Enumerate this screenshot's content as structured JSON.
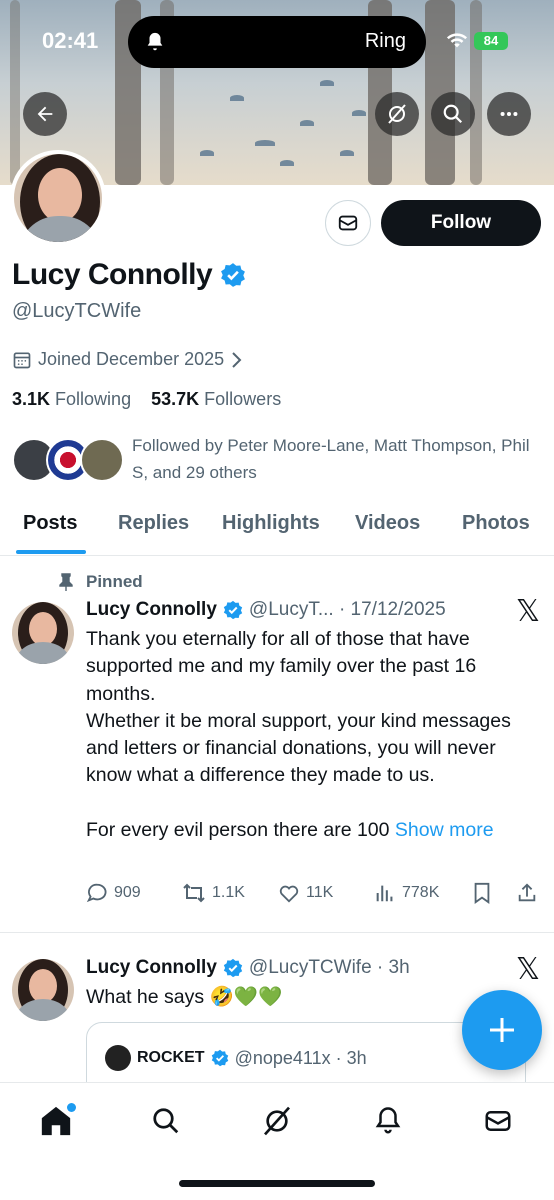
{
  "status_bar": {
    "time": "02:41",
    "live_activity": "Ring",
    "battery": "84"
  },
  "profile": {
    "name": "Lucy Connolly",
    "handle": "@LucyTCWife",
    "joined": "Joined December 2025",
    "following_count": "3.1K",
    "following_label": "Following",
    "followers_count": "53.7K",
    "followers_label": "Followers",
    "followed_by": "Followed by Peter Moore-Lane, Matt Thompson, Phil S, and 29 others",
    "follow_label": "Follow"
  },
  "tabs": [
    "Posts",
    "Replies",
    "Highlights",
    "Videos",
    "Photos"
  ],
  "tweets": [
    {
      "pinned_label": "Pinned",
      "name": "Lucy Connolly",
      "handle_date": "@LucyT... · 17/12/2025",
      "text_lines": [
        "Thank you eternally for all of those that have supported me and my family over the past 16 months.",
        "Whether it be moral support, your kind messages and letters or financial donations, you will never know what a difference they made to us.",
        "",
        "For every evil person there are 100"
      ],
      "show_more": "Show more",
      "replies": "909",
      "reposts": "1.1K",
      "likes": "11K",
      "views": "778K"
    },
    {
      "name": "Lucy Connolly",
      "handle_date": "@LucyTCWife · 3h",
      "text": "What he says 🤣💚💚",
      "quote": {
        "name": "ROCKET",
        "handle_date": "@nope411x · 3h"
      }
    }
  ],
  "colors": {
    "accent": "#1d9bf0",
    "text": "#0f1419",
    "muted": "#536471",
    "battery": "#34c759"
  }
}
